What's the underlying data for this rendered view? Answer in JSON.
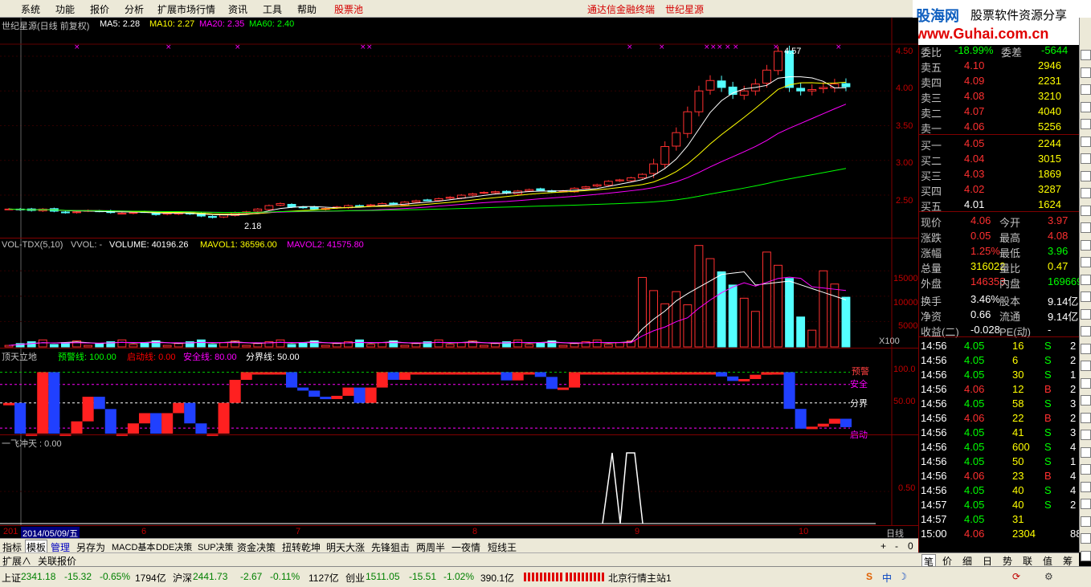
{
  "menu": [
    "系统",
    "功能",
    "报价",
    "分析",
    "扩展市场行情",
    "资讯",
    "工具",
    "帮助"
  ],
  "menu_pool": "股票池",
  "title_center": [
    "通达信金融终端",
    "世纪星源"
  ],
  "logo": {
    "l1": "股海网",
    "l2": "股票软件资源分享",
    "l3": "www.Guhai.com.cn"
  },
  "main_title": "世纪星源(日线 前复权)",
  "ma": {
    "ma5": "MA5: 2.28",
    "ma10": "MA10: 2.27",
    "ma20": "MA20: 2.35",
    "ma60": "MA60: 2.40"
  },
  "price_axis": [
    "4.50",
    "4.00",
    "3.50",
    "3.00",
    "2.50"
  ],
  "hi_label": "4.57",
  "lo_label": "2.18",
  "vol_title": {
    "a": "VOL-TDX(5,10)",
    "b": "VVOL: -",
    "c": "VOLUME: 40196.26",
    "d": "MAVOL1: 36596.00",
    "e": "MAVOL2: 41575.80"
  },
  "vol_axis": [
    "15000",
    "10000",
    "5000",
    "X100"
  ],
  "ind_title": {
    "a": "顶天立地",
    "b": "预警线: 100.00",
    "c": "启动线: 0.00",
    "d": "安全线: 80.00",
    "e": "分界线: 50.00"
  },
  "ind_axis": [
    "100.0",
    "50.00"
  ],
  "ind_labels": {
    "warn": "预警",
    "safe": "安全",
    "div": "分界",
    "start": "启动"
  },
  "fly_title": "一飞冲天 : 0.00",
  "fly_axis": "0.50",
  "date_axis": [
    "201",
    "2014/05/09/五",
    "6",
    "7",
    "8",
    "9",
    "10"
  ],
  "period": "日线",
  "tabs": [
    "指标",
    "模板",
    "管理",
    "另存为",
    "MACD基本",
    "DDE决策",
    "SUP决策",
    "资金决策",
    "扭转乾坤",
    "明天大涨",
    "先锋狙击",
    "两周半",
    "一夜情",
    "短线王"
  ],
  "tabs2": [
    "扩展∧",
    "关联报价"
  ],
  "order": {
    "wb": "委比",
    "wbv": "-18.99%",
    "wc": "委差",
    "wcv": "-5644",
    "sell": [
      [
        "卖五",
        "4.10",
        "2946"
      ],
      [
        "卖四",
        "4.09",
        "2231"
      ],
      [
        "卖三",
        "4.08",
        "3210"
      ],
      [
        "卖二",
        "4.07",
        "4040"
      ],
      [
        "卖一",
        "4.06",
        "5256"
      ]
    ],
    "buy": [
      [
        "买一",
        "4.05",
        "2244"
      ],
      [
        "买二",
        "4.04",
        "3015"
      ],
      [
        "买三",
        "4.03",
        "1869"
      ],
      [
        "买四",
        "4.02",
        "3287"
      ],
      [
        "买五",
        "4.01",
        "1624"
      ]
    ]
  },
  "quote": [
    [
      "现价",
      "4.06",
      "今开",
      "3.97"
    ],
    [
      "涨跌",
      "0.05",
      "最高",
      "4.08"
    ],
    [
      "涨幅",
      "1.25%",
      "最低",
      "3.96"
    ],
    [
      "总量",
      "316022",
      "量比",
      "0.47"
    ],
    [
      "外盘",
      "146353",
      "内盘",
      "169669"
    ],
    [
      "换手",
      "3.46%",
      "股本",
      "9.14亿"
    ],
    [
      "净资",
      "0.66",
      "流通",
      "9.14亿"
    ],
    [
      "收益(二)",
      "-0.028",
      "PE(动)",
      "-"
    ]
  ],
  "ticks": [
    [
      "14:56",
      "4.05",
      "16",
      "S",
      "2"
    ],
    [
      "14:56",
      "4.05",
      "6",
      "S",
      "2"
    ],
    [
      "14:56",
      "4.05",
      "30",
      "S",
      "1"
    ],
    [
      "14:56",
      "4.06",
      "12",
      "B",
      "2"
    ],
    [
      "14:56",
      "4.05",
      "58",
      "S",
      "3"
    ],
    [
      "14:56",
      "4.06",
      "22",
      "B",
      "2"
    ],
    [
      "14:56",
      "4.05",
      "41",
      "S",
      "3"
    ],
    [
      "14:56",
      "4.05",
      "600",
      "S",
      "4"
    ],
    [
      "14:56",
      "4.05",
      "50",
      "S",
      "1"
    ],
    [
      "14:56",
      "4.06",
      "23",
      "B",
      "4"
    ],
    [
      "14:56",
      "4.05",
      "40",
      "S",
      "4"
    ],
    [
      "14:57",
      "4.05",
      "40",
      "S",
      "2"
    ],
    [
      "14:57",
      "4.05",
      "31",
      "",
      ""
    ],
    [
      "15:00",
      "4.06",
      "2304",
      "",
      "88"
    ]
  ],
  "rtabs": [
    "笔",
    "价",
    "细",
    "日",
    "势",
    "联",
    "值",
    "筹"
  ],
  "status": {
    "sh": "上证",
    "shv": "2341.18",
    "shc": "-15.32",
    "shp": "-0.65%",
    "sha": "1794亿",
    "sz": "沪深",
    "szv": "2441.73",
    "szc": "-2.67",
    "szp": "-0.11%",
    "sza": "1127亿",
    "cy": "创业",
    "cyv": "1511.05",
    "cyc": "-15.51",
    "cyp": "-1.02%",
    "cya": "390.1亿",
    "server": "北京行情主站1"
  },
  "chart_data": {
    "type": "candlestick",
    "closes": [
      2.3,
      2.29,
      2.28,
      2.3,
      2.27,
      2.25,
      2.26,
      2.28,
      2.27,
      2.25,
      2.24,
      2.25,
      2.26,
      2.22,
      2.24,
      2.25,
      2.23,
      2.2,
      2.18,
      2.22,
      2.25,
      2.26,
      2.3,
      2.35,
      2.38,
      2.33,
      2.32,
      2.3,
      2.31,
      2.33,
      2.35,
      2.34,
      2.36,
      2.38,
      2.37,
      2.4,
      2.42,
      2.43,
      2.45,
      2.47,
      2.5,
      2.52,
      2.54,
      2.55,
      2.53,
      2.56,
      2.58,
      2.57,
      2.55,
      2.56,
      2.6,
      2.62,
      2.65,
      2.7,
      2.72,
      2.75,
      2.8,
      2.95,
      3.2,
      3.4,
      3.7,
      4.0,
      4.15,
      4.05,
      3.95,
      4.0,
      4.1,
      4.3,
      4.57,
      4.05,
      4.0,
      4.02,
      4.05,
      4.1,
      4.06
    ]
  }
}
